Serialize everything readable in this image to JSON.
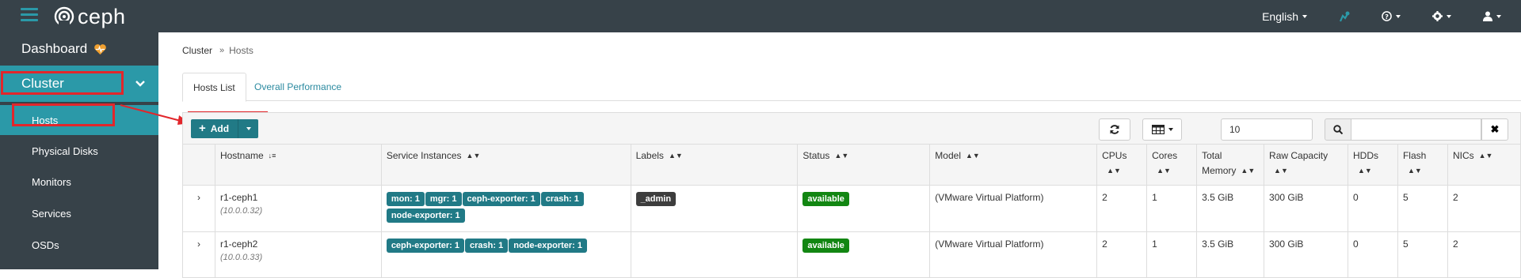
{
  "topbar": {
    "logo_text": "ceph",
    "language": "English",
    "icons": [
      "hamburger-icon",
      "task-manager-icon",
      "help-icon",
      "settings-icon",
      "user-icon"
    ]
  },
  "sidebar": {
    "dashboard": "Dashboard",
    "cluster": "Cluster",
    "items": [
      {
        "label": "Hosts"
      },
      {
        "label": "Physical Disks"
      },
      {
        "label": "Monitors"
      },
      {
        "label": "Services"
      },
      {
        "label": "OSDs"
      }
    ]
  },
  "breadcrumb": {
    "parent": "Cluster",
    "separator": "»",
    "current": "Hosts"
  },
  "tabs": [
    {
      "label": "Hosts List"
    },
    {
      "label": "Overall Performance"
    }
  ],
  "toolbar": {
    "add_label": "Add",
    "page_size": "10",
    "search_value": ""
  },
  "table": {
    "columns": [
      "Hostname",
      "Service Instances",
      "Labels",
      "Status",
      "Model",
      "CPUs",
      "Cores",
      "Total Memory",
      "Raw Capacity",
      "HDDs",
      "Flash",
      "NICs"
    ],
    "rows": [
      {
        "hostname": "r1-ceph1",
        "ip": "(10.0.0.32)",
        "services": [
          "mon: 1",
          "mgr: 1",
          "ceph-exporter: 1",
          "crash: 1",
          "node-exporter: 1"
        ],
        "labels": [
          "_admin"
        ],
        "status": "available",
        "model": "(VMware Virtual Platform)",
        "cpus": "2",
        "cores": "1",
        "memory": "3.5 GiB",
        "raw": "300 GiB",
        "hdds": "0",
        "flash": "5",
        "nics": "2"
      },
      {
        "hostname": "r1-ceph2",
        "ip": "(10.0.0.33)",
        "services": [
          "ceph-exporter: 1",
          "crash: 1",
          "node-exporter: 1"
        ],
        "labels": [],
        "status": "available",
        "model": "(VMware Virtual Platform)",
        "cpus": "2",
        "cores": "1",
        "memory": "3.5 GiB",
        "raw": "300 GiB",
        "hdds": "0",
        "flash": "5",
        "nics": "2"
      }
    ]
  },
  "colors": {
    "topbar": "#374249",
    "accent": "#2b99a8",
    "badge": "#217a86",
    "status_ok": "#128612",
    "highlight": "#e2262b"
  }
}
